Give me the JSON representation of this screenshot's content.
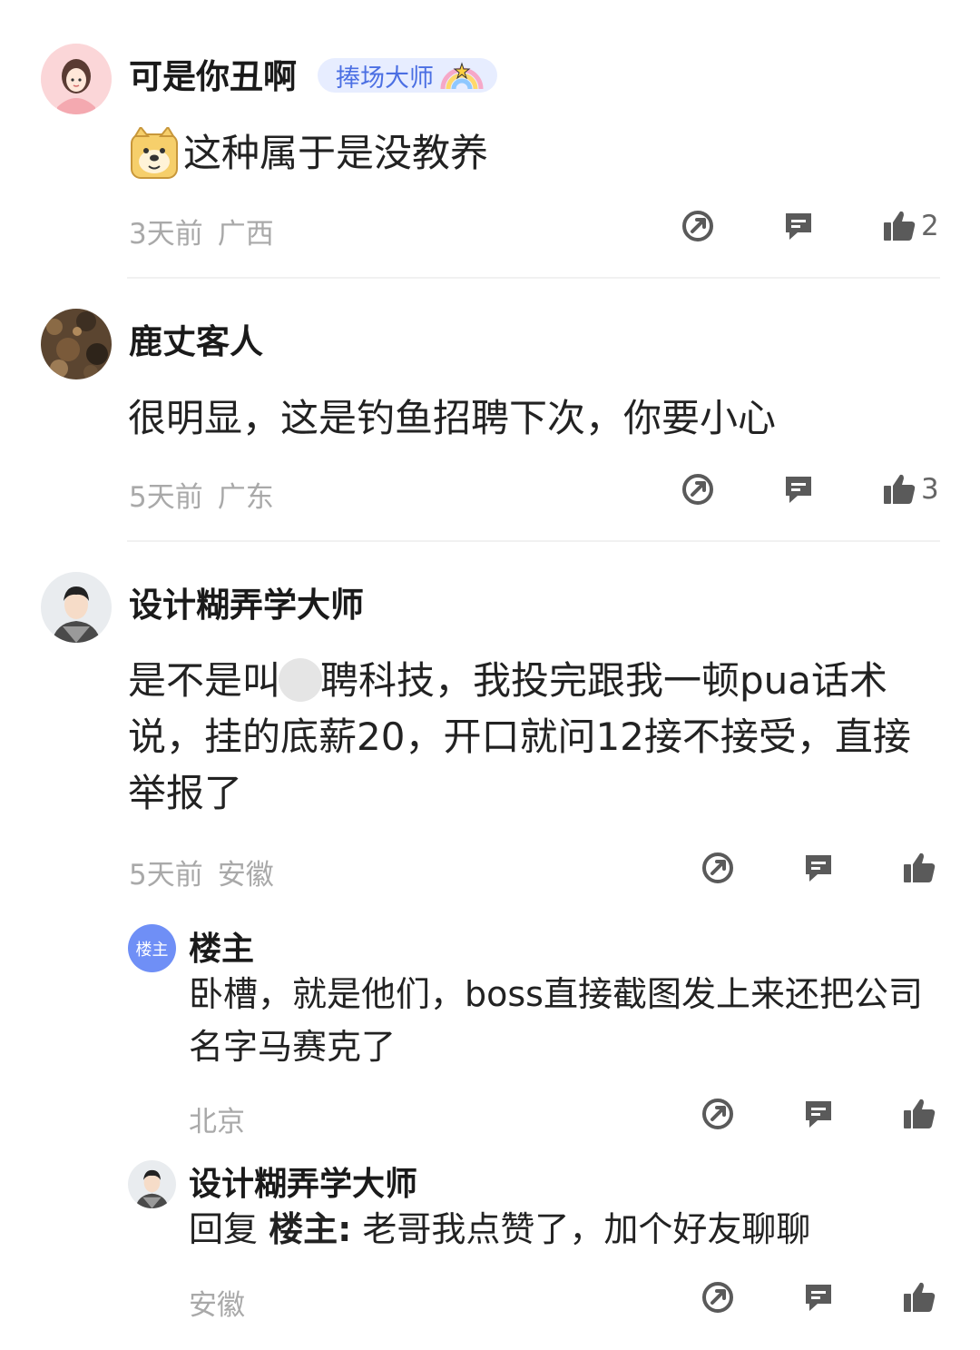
{
  "comments": [
    {
      "name": "可是你丑啊",
      "badge": "捧场大师",
      "text": "这种属于是没教养",
      "time": "3天前",
      "location": "广西",
      "likes": "2"
    },
    {
      "name": "鹿丈客人",
      "text": "很明显，这是钓鱼招聘下次，你要小心",
      "time": "5天前",
      "location": "广东",
      "likes": "3"
    },
    {
      "name": "设计糊弄学大师",
      "text_before": "是不是叫",
      "text_after": "聘科技，我投完跟我一顿pua话术说，挂的底薪20，开口就问12接不接受，直接举报了",
      "time": "5天前",
      "location": "安徽",
      "replies": [
        {
          "name": "楼主",
          "avatar_label": "楼主",
          "text": "卧槽，就是他们，boss直接截图发上来还把公司名字马赛克了",
          "location": "北京"
        },
        {
          "name": "设计糊弄学大师",
          "reply_prefix": "回复",
          "reply_target": "楼主:",
          "text": "老哥我点赞了，加个好友聊聊",
          "location": "安徽"
        }
      ]
    }
  ],
  "icons": {
    "share": "share-icon",
    "reply": "comment-icon",
    "like": "thumbs-up-icon"
  },
  "colors": {
    "badge_bg": "#e7edff",
    "badge_text": "#4b6fe3",
    "meta": "#a9a9a9",
    "icon": "#5a5a5a",
    "owner_avatar": "#6f8ff6"
  }
}
